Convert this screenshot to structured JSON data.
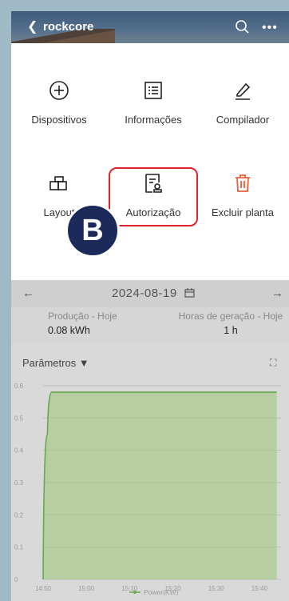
{
  "header": {
    "title": "rockcore",
    "back_icon": "back-chevron-icon",
    "search_icon": "search-icon",
    "more_icon": "more-icon"
  },
  "menu": {
    "items": [
      {
        "label": "Dispositivos",
        "icon": "add-circle-icon"
      },
      {
        "label": "Informações",
        "icon": "list-icon"
      },
      {
        "label": "Compilador",
        "icon": "pencil-icon"
      },
      {
        "label": "Layout",
        "icon": "layout-icon"
      },
      {
        "label": "Autorização",
        "icon": "authorization-icon"
      },
      {
        "label": "Excluir planta",
        "icon": "trash-icon"
      }
    ]
  },
  "badge": "B",
  "datebar": {
    "date": "2024-08-19",
    "prev": "←",
    "next": "→"
  },
  "stats": {
    "production_label": "Produção - Hoje",
    "production_value": "0.08 kWh",
    "hours_label": "Horas de geração - Hoje",
    "hours_value": "1 h"
  },
  "params": {
    "label": "Parâmetros ▼",
    "expand": "⛶"
  },
  "colors": {
    "accent_red": "#e0222b",
    "trash_orange": "#e5603a",
    "series": "#6aa84f",
    "fill": "#a9c98f",
    "badge": "#1b2a5a"
  },
  "chart_data": {
    "type": "area",
    "x": [
      "14:50",
      "14:51",
      "14:52",
      "14:53",
      "15:44"
    ],
    "series": [
      {
        "name": "Power(KW)",
        "values": [
          0,
          0.45,
          0.58,
          0.58,
          0.58
        ]
      }
    ],
    "x_ticks": [
      "14:50",
      "15:00",
      "15:10",
      "15:20",
      "15:30",
      "15:40"
    ],
    "y_ticks": [
      "0",
      "0.1",
      "0.2",
      "0.3",
      "0.4",
      "0.5",
      "0.6"
    ],
    "ylim": [
      0,
      0.6
    ],
    "grid": true,
    "legend": "bottom"
  }
}
